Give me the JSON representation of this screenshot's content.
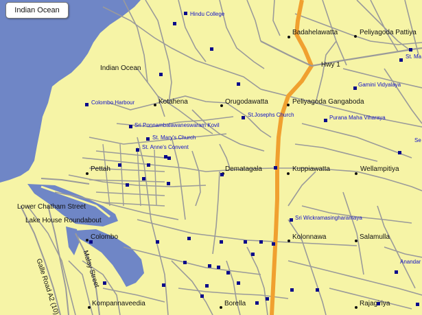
{
  "map": {
    "location_box": "Indian Ocean",
    "colors": {
      "land": "#f6f4a6",
      "sea": "#6f86c6",
      "minor_road": "#9a9a9a",
      "highway": "#f0a030",
      "poi": "#1010c8"
    },
    "water_labels": {
      "indian_ocean": "Indian Ocean"
    },
    "road_labels": {
      "hwy1": "Hwy 1",
      "galle_road": "Galle Road A2 (10)",
      "marine_street": "Malay Street"
    },
    "places": {
      "badahelawatta": "Badahelawatta",
      "peliyagoda_pattiya": "Peliyagoda Pattiya",
      "kotahena": "Kotahena",
      "orugodawatta": "Orugodawatta",
      "peliyagoda_gangaboda": "Peliyagoda Gangaboda",
      "pettah": "Pettah",
      "dematagala": "Dematagala",
      "kuppiawatta": "Kuppiawatta",
      "wellampitiya": "Wellampitiya",
      "lower_chatham": "Lower Chatham Street",
      "lake_house": "Lake House Roundabout",
      "colombo": "Colombo",
      "kolonnawa": "Kolonnawa",
      "salamulla": "Salamulla",
      "kompannaveediya": "Kompannaveedia",
      "borella": "Borella",
      "rajagiriya": "Rajagiriya"
    },
    "pois": {
      "hindu_college": "Hindu College",
      "colombo_harbour": "Colombo Harbour",
      "sri_ponnambalawaneswaram": "Sri Ponnambalawaneswaram Kovil",
      "st_marys": "St. Mary's Church",
      "st_annes": "St. Anne's Convent",
      "st_josephs": "St.Josephs Church",
      "gamini_vidyalaya": "Gamini Vidyalaya",
      "purana_maha_viharaya": "Purana Maha Viharaya",
      "sri_wickramasingharamaya": "Sri Wickramasingharamaya",
      "st_ma": "St. Ma",
      "se": "Se",
      "anandar": "Anandar"
    }
  }
}
